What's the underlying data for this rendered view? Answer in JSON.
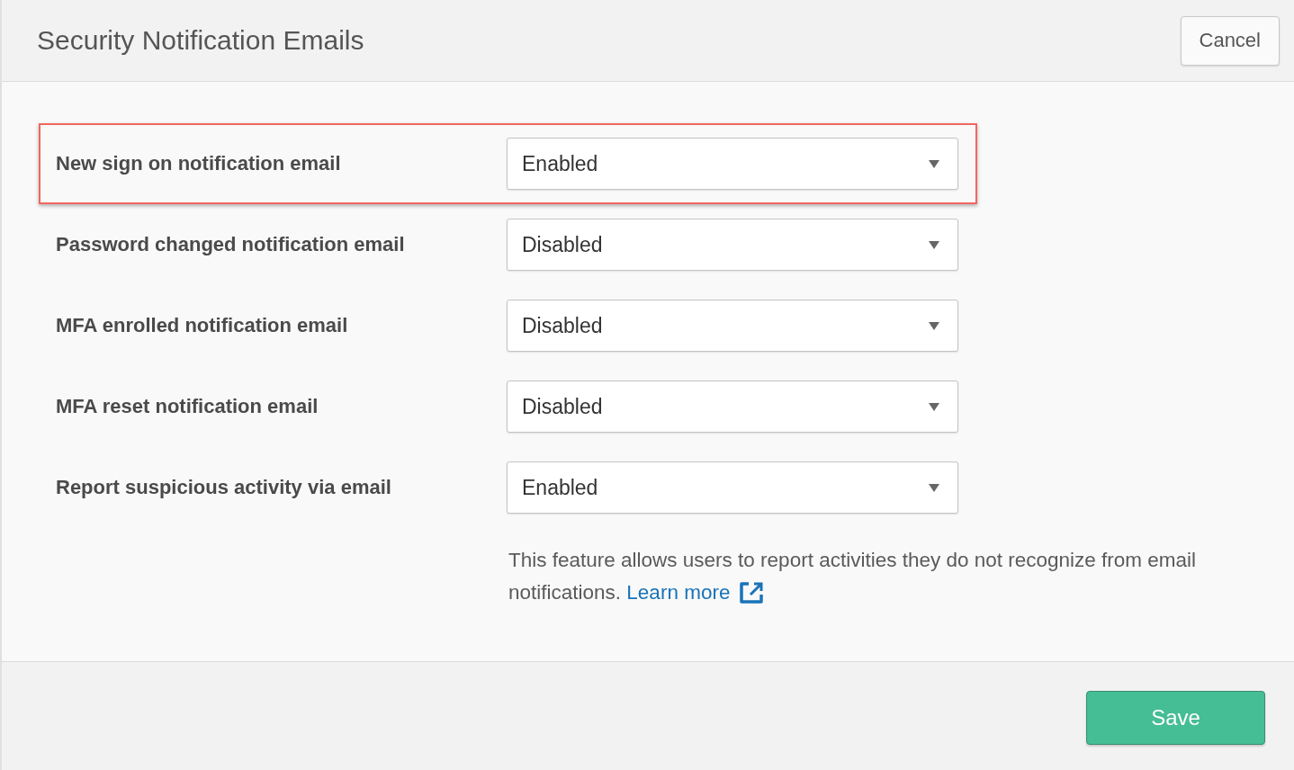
{
  "dialog": {
    "title": "Security Notification Emails",
    "cancel_button": "Cancel"
  },
  "settings": [
    {
      "label": "New sign on notification email",
      "value": "Enabled",
      "highlighted": true
    },
    {
      "label": "Password changed notification email",
      "value": "Disabled",
      "highlighted": false
    },
    {
      "label": "MFA enrolled notification email",
      "value": "Disabled",
      "highlighted": false
    },
    {
      "label": "MFA reset notification email",
      "value": "Disabled",
      "highlighted": false
    },
    {
      "label": "Report suspicious activity via email",
      "value": "Enabled",
      "highlighted": false
    }
  ],
  "description": {
    "text": "This feature allows users to report activities they do not recognize from email notifications.",
    "link": "Learn more"
  },
  "footer": {
    "save_button": "Save"
  }
}
